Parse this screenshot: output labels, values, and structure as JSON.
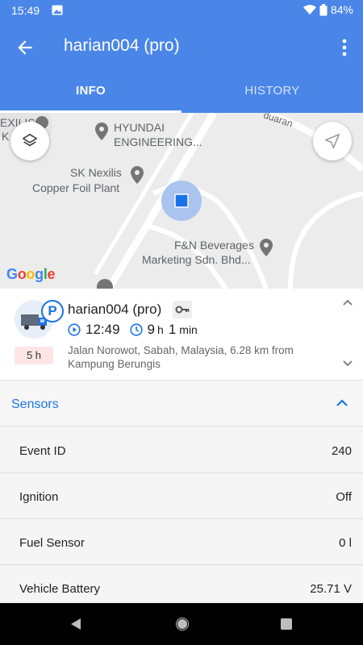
{
  "status_bar": {
    "time": "15:49",
    "battery": "84%"
  },
  "header": {
    "title": "harian004 (pro)",
    "tabs": [
      "INFO",
      "HISTORY"
    ]
  },
  "map": {
    "pois": [
      "HYUNDAI",
      "ENGINEERING...",
      "SK Nexilis",
      "Copper Foil Plant",
      "F&N Beverages",
      "Marketing Sdn. Bhd...",
      "EXILIS",
      "K",
      "duaran"
    ],
    "attribution": "Google"
  },
  "vehicle": {
    "name": "harian004 (pro)",
    "parked_badge": "P",
    "age": "5 h",
    "time": "12:49",
    "duration_h": "9",
    "duration_h_unit": "h",
    "duration_m": "1",
    "duration_m_unit": "min",
    "address": "Jalan Norowot, Sabah, Malaysia, 6.28 km from Kampung Berungis"
  },
  "sensors": {
    "title": "Sensors",
    "rows": [
      {
        "label": "Event ID",
        "value": "240"
      },
      {
        "label": "Ignition",
        "value": "Off"
      },
      {
        "label": "Fuel Sensor",
        "value": "0 l"
      },
      {
        "label": "Vehicle Battery",
        "value": "25.71 V"
      }
    ]
  },
  "colors": {
    "primary": "#4a86e8",
    "accent": "#1a73e8"
  }
}
